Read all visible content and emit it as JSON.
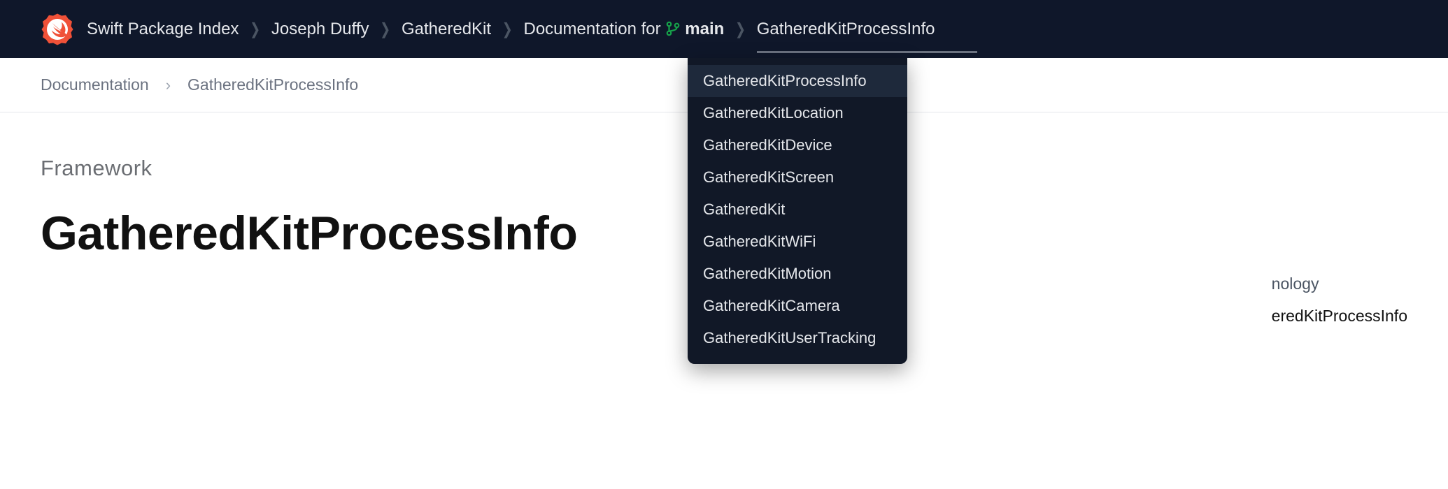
{
  "nav": {
    "brand_label": "Swift Package Index",
    "owner": "Joseph Duffy",
    "repo": "GatheredKit",
    "docs_for_prefix": "Documentation for",
    "branch": "main",
    "current_module": "GatheredKitProcessInfo"
  },
  "breadcrumb": {
    "root": "Documentation",
    "current": "GatheredKitProcessInfo"
  },
  "page": {
    "eyebrow": "Framework",
    "title": "GatheredKitProcessInfo"
  },
  "sidebar": {
    "label_tail": "nology",
    "value_tail": "eredKitProcessInfo"
  },
  "dropdown": {
    "items": [
      "GatheredKitProcessInfo",
      "GatheredKitLocation",
      "GatheredKitDevice",
      "GatheredKitScreen",
      "GatheredKit",
      "GatheredKitWiFi",
      "GatheredKitMotion",
      "GatheredKitCamera",
      "GatheredKitUserTracking"
    ],
    "active_index": 0
  },
  "colors": {
    "navbar": "#0f172a",
    "dropdown": "#111827",
    "accent_swift": "#f05138"
  }
}
